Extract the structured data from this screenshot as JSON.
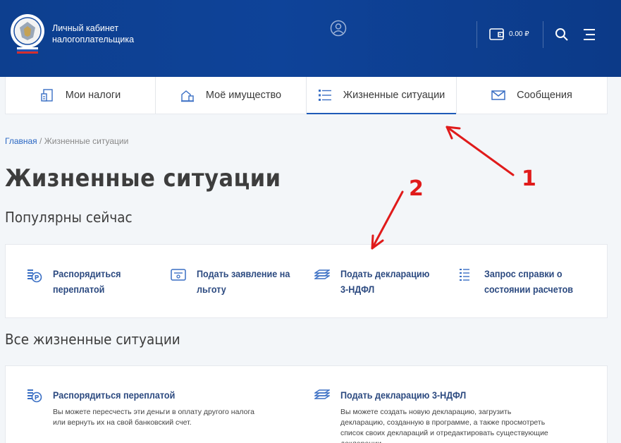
{
  "header": {
    "brand_line1": "Личный кабинет",
    "brand_line2": "налогоплательщика",
    "balance": "0.00 ₽",
    "colors": {
      "header_bg": "#0e4399",
      "accent": "#1f5bb8",
      "link": "#2c4a80"
    }
  },
  "tabs": [
    {
      "label": "Мои налоги",
      "icon": "taxes-icon"
    },
    {
      "label": "Моё имущество",
      "icon": "property-icon"
    },
    {
      "label": "Жизненные ситуации",
      "icon": "list-icon",
      "active": true
    },
    {
      "label": "Сообщения",
      "icon": "envelope-icon"
    }
  ],
  "breadcrumb": {
    "home": "Главная",
    "separator": " / ",
    "current": "Жизненные ситуации"
  },
  "page_title": "Жизненные ситуации",
  "popular": {
    "heading": "Популярны сейчас",
    "items": [
      {
        "label": "Распорядиться переплатой",
        "icon": "coins-ruble-icon"
      },
      {
        "label": "Подать заявление на льготу",
        "icon": "document-form-icon"
      },
      {
        "label": "Подать декларацию 3-НДФЛ",
        "icon": "declaration-stack-icon"
      },
      {
        "label": "Запрос справки о состоянии расчетов",
        "icon": "list-lines-icon"
      }
    ]
  },
  "all": {
    "heading": "Все жизненные ситуации",
    "items": [
      {
        "title": "Распорядиться переплатой",
        "desc": "Вы можете пересчесть эти деньги в оплату другого налога или вернуть их на свой банковский счет.",
        "icon": "coins-ruble-icon"
      },
      {
        "title": "Подать декларацию 3-НДФЛ",
        "desc": "Вы можете создать новую декларацию, загрузить декларацию, созданную в программе, а также просмотреть список своих деклараций и отредактировать существующие декларации",
        "icon": "declaration-stack-icon"
      }
    ]
  },
  "annotations": {
    "n1": "1",
    "n2": "2",
    "color": "#e01b1b"
  }
}
